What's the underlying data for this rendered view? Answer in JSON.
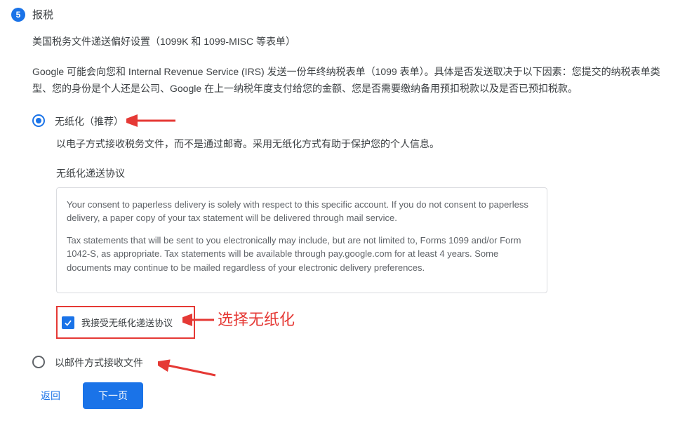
{
  "step": {
    "number": "5",
    "title": "报税"
  },
  "subtitle": "美国税务文件递送偏好设置（1099K 和 1099-MISC 等表单）",
  "description": "Google 可能会向您和 Internal Revenue Service (IRS) 发送一份年终纳税表单（1099 表单）。具体是否发送取决于以下因素：您提交的纳税表单类型、您的身份是个人还是公司、Google 在上一纳税年度支付给您的金额、您是否需要缴纳备用预扣税款以及是否已预扣税款。",
  "options": {
    "paperless": {
      "label": "无纸化（推荐）",
      "desc": "以电子方式接收税务文件，而不是通过邮寄。采用无纸化方式有助于保护您的个人信息。",
      "agreement_title": "无纸化递送协议",
      "agreement_p1": "Your consent to paperless delivery is solely with respect to this specific account. If you do not consent to paperless delivery, a paper copy of your tax statement will be delivered through mail service.",
      "agreement_p2": "Tax statements that will be sent to you electronically may include, but are not limited to, Forms 1099 and/or Form 1042-S, as appropriate. Tax statements will be available through pay.google.com for at least 4 years. Some documents may continue to be mailed regardless of your electronic delivery preferences.",
      "checkbox_label": "我接受无纸化递送协议"
    },
    "mail": {
      "label": "以邮件方式接收文件"
    }
  },
  "buttons": {
    "back": "返回",
    "next": "下一页"
  },
  "annotations": {
    "select_paperless": "选择无纸化"
  }
}
